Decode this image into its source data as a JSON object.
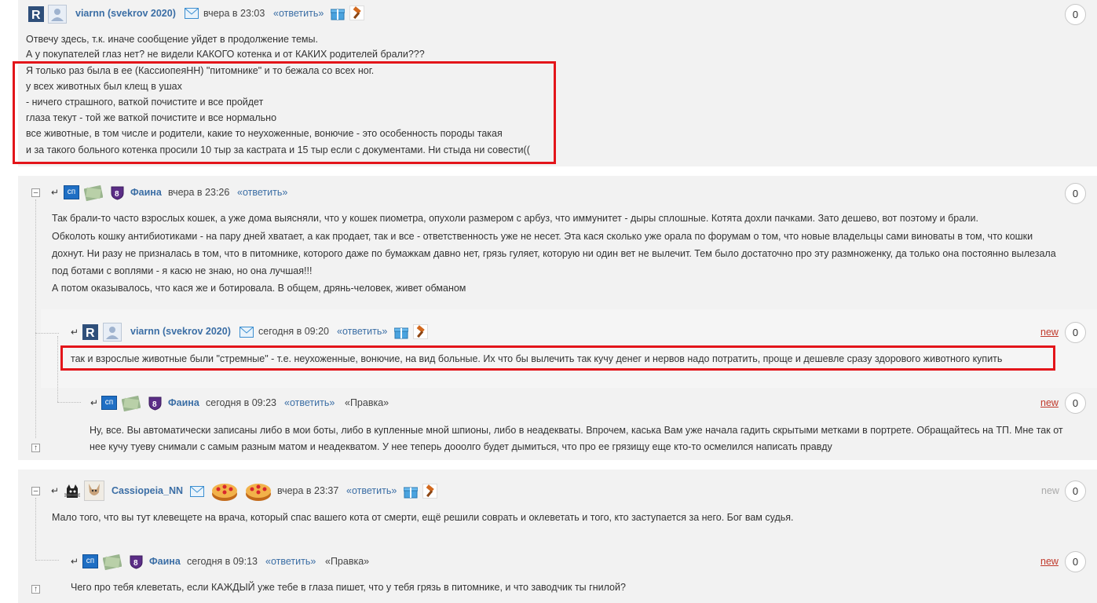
{
  "comments": [
    {
      "author": "viarnn (svekrov 2020)",
      "date": "вчера в 23:03",
      "reply": "«ответить»",
      "count": "0",
      "lines": [
        "Отвечу здесь, т.к. иначе сообщение уйдет в продолжение темы.",
        "А у покупателей глаз нет? не видели КАКОГО котенка и от КАКИХ родителей брали???",
        "Я только раз была в ее (КассиопеяНН) \"питомнике\" и то бежала со всех ног.",
        "у всех животных был клещ в ушах",
        "- ничего страшного, ваткой почистите и все пройдет",
        "глаза текут - той же ваткой почистите и все нормально",
        "все животные, в том числе и родители, какие то неухоженные, вонючие - это особенность породы такая",
        "и за такого больного котенка просили 10 тыр за кастрата и 15 тыр если с документами. Ни стыда ни совести(("
      ]
    },
    {
      "author": "Фаина",
      "date": "вчера в 23:26",
      "reply": "«ответить»",
      "count": "0",
      "lines": [
        "Так брали-то часто взрослых кошек, а уже дома выясняли, что у кошек пиометра, опухоли размером с арбуз, что иммунитет - дыры сплошные. Котята дохли пачками. Зато дешево, вот поэтому и брали.",
        "Обколоть кошку антибиотиками - на пару дней хватает, а как продает, так и все - ответственность уже не несет. Эта кася сколько уже орала по форумам о том, что новые владельцы сами виноваты в том, что кошки",
        "дохнут. Ни разу не призналась в том, что в питомнике, которого даже по бумажкам давно нет, грязь гуляет, которую ни один вет не вылечит. Тем было достаточно про эту размноженку, да только она постоянно вылезала",
        "под ботами с воплями - я касю не знаю, но она лучшая!!!",
        "А потом оказывалось, что кася же и ботировала. В общем, дрянь-человек, живет обманом"
      ]
    },
    {
      "author": "viarnn (svekrov 2020)",
      "date": "сегодня в 09:20",
      "reply": "«ответить»",
      "new": "new",
      "count": "0",
      "lines": [
        "так и взрослые животные были \"стремные\" - т.е. неухоженные, вонючие, на вид больные. Их что бы вылечить так кучу денег и нервов надо потратить, проще и дешевле сразу здорового животного купить"
      ]
    },
    {
      "author": "Фаина",
      "date": "сегодня в 09:23",
      "reply": "«ответить»",
      "edited": "«Правка»",
      "new": "new",
      "count": "0",
      "lines": [
        "Ну, все. Вы автоматически записаны либо в мои боты, либо в купленные мной шпионы, либо в неадекваты. Впрочем, каська Вам уже начала гадить скрытыми метками в портрете. Обращайтесь на ТП. Мне так от",
        "нее кучу туеву снимали с самым разным матом и неадекватом. У нее теперь дооолго будет дымиться, что про ее грязищу еще кто-то осмелился написать правду"
      ]
    },
    {
      "author": "Cassiopeia_NN",
      "date": "вчера в 23:37",
      "reply": "«ответить»",
      "new": "new",
      "count": "0",
      "lines": [
        "Мало того, что вы тут клевещете на врача, который спас вашего кота от смерти, ещё решили соврать и оклеветать и того, кто заступается за него. Бог вам судья."
      ]
    },
    {
      "author": "Фаина",
      "date": "сегодня в 09:13",
      "reply": "«ответить»",
      "edited": "«Правка»",
      "new": "new",
      "count": "0",
      "lines": [
        "Чего про тебя клеветать, если КАЖДЫЙ уже тебе в глаза пишет, что у тебя грязь в питомнике, и что заводчик ты гнилой?"
      ]
    }
  ],
  "badges": {
    "sp": "сп",
    "rank": "8",
    "toggle_minus": "–",
    "reply_arrow": "↵",
    "up_arrow": "↑"
  },
  "colors": {
    "accent": "#3b6ea5",
    "highlight_box": "#e3151a",
    "new_link": "#c0392b",
    "panel": "#f2f2f2"
  },
  "icons": [
    "r-logo-icon",
    "avatar-icon",
    "mail-icon",
    "gift-icon",
    "hammer-icon",
    "sp-badge-icon",
    "money-icon",
    "shield-icon",
    "cat-icon",
    "cake-icon"
  ]
}
